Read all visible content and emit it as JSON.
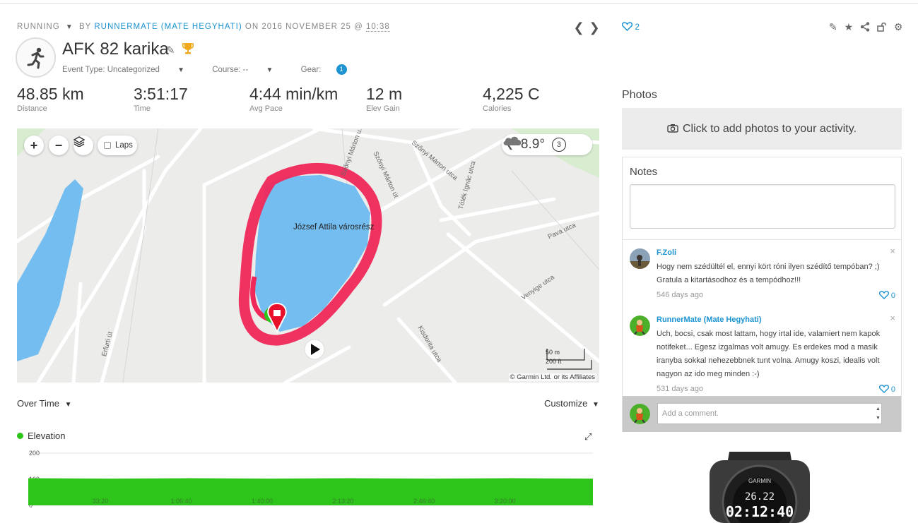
{
  "header": {
    "activity_type": "RUNNING",
    "by": "BY",
    "author_link": "RUNNERMATE (MATE HEGYHATI)",
    "on": "ON 2016 NOVEMBER 25 @",
    "time": "10:38",
    "title": "AFK 82 karika",
    "event_type": "Event Type: Uncategorized",
    "course": "Course: --",
    "gear": "Gear:",
    "gear_count": "1",
    "likes": "2"
  },
  "stats": [
    {
      "value": "48.85 km",
      "label": "Distance"
    },
    {
      "value": "3:51:17",
      "label": "Time"
    },
    {
      "value": "4:44 min/km",
      "label": "Avg Pace"
    },
    {
      "value": "12 m",
      "label": "Elev Gain"
    },
    {
      "value": "4,225 C",
      "label": "Calories"
    }
  ],
  "map": {
    "laps_label": "Laps",
    "temperature": "8.9°",
    "wind_number": "3",
    "place_label": "József Attila városrész",
    "streets": [
      "Szőnyi Márton u.",
      "Szőnyi Márton út",
      "Szőnyi Márton utca",
      "Tóték Ignác utca",
      "Pava utca",
      "Venyige utca",
      "Kisdorita utca",
      "Erfurti út"
    ],
    "scale_m": "50 m",
    "scale_ft": "200 ft",
    "attribution": "© Garmin Ltd. or its Affiliates"
  },
  "chart_controls": {
    "over_time": "Over Time",
    "customize": "Customize"
  },
  "chart_data": {
    "type": "area",
    "title": "",
    "legend": [
      "Elevation"
    ],
    "ylim": [
      0,
      200
    ],
    "yticks": [
      "200",
      "100",
      "0"
    ],
    "x_tick_labels": [
      "33:20",
      "1:06:40",
      "1:40:00",
      "2:13:20",
      "2:46:40",
      "3:20:00"
    ],
    "x": [
      "0:00",
      "33:20",
      "1:06:40",
      "1:40:00",
      "2:13:20",
      "2:46:40",
      "3:20:00",
      "3:51:17"
    ],
    "series": [
      {
        "name": "Elevation",
        "values": [
          104,
          104,
          104,
          104,
          104,
          104,
          104,
          104
        ]
      }
    ],
    "color": "#2ec51b"
  },
  "photos": {
    "title": "Photos",
    "add_text": "Click to add photos to your activity."
  },
  "notes": {
    "title": "Notes",
    "comments": [
      {
        "author": "F.Zoli",
        "text": "Hogy nem szédültél el, ennyi kört róni ilyen szédítő tempóban? ;) Gratula a kitartásodhoz és a tempódhoz!!!",
        "age": "546 days ago",
        "likes": "0"
      },
      {
        "author": "RunnerMate (Mate Hegyhati)",
        "text": "Uch, bocsi, csak most lattam, hogy irtal ide, valamiert nem kapok notifeket... Egesz izgalmas volt amugy. Es erdekes mod a masik iranyba sokkal nehezebbnek tunt volna. Amugy koszi, idealis volt nagyon az ido meg minden :-)",
        "age": "531 days ago",
        "likes": "0"
      }
    ],
    "add_comment_placeholder": "Add a comment."
  },
  "watch": {
    "brand": "GARMIN",
    "line1": "26.22",
    "line2": "02:12:40"
  },
  "colors": {
    "accent": "#1d93d2",
    "track": "#f0285a",
    "lake": "#74bdf0",
    "elevation": "#2ec51b"
  }
}
